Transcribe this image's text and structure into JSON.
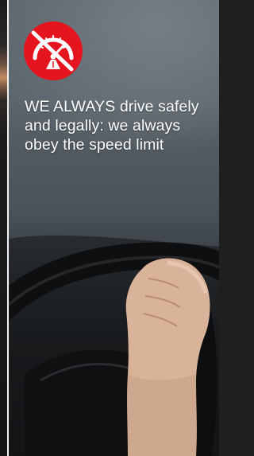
{
  "panel": {
    "icon": "no-speeding-icon",
    "badge_color": "#e4151e",
    "headline_lead": "WE ALWAYS",
    "headline_rest": " drive safely and legally: we always obey the speed limit"
  }
}
